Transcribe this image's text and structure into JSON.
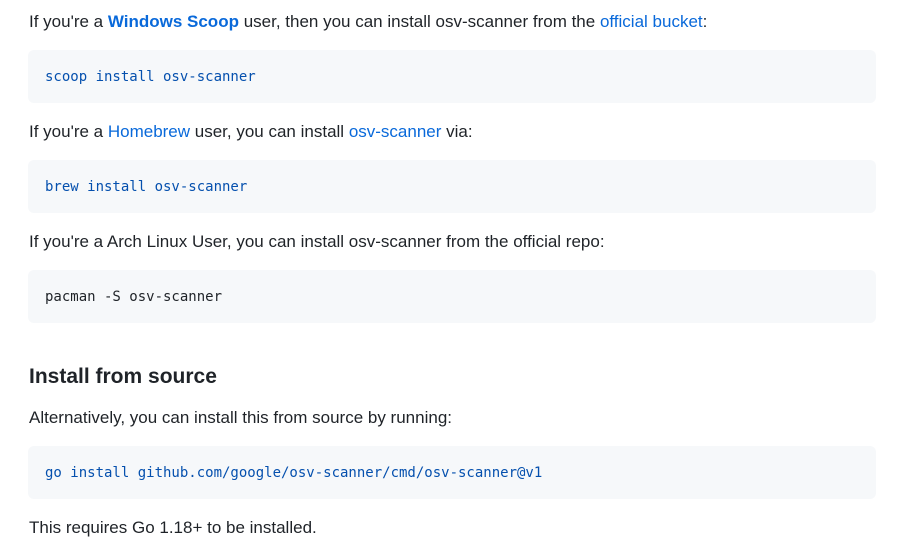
{
  "scoop_paragraph": {
    "prefix": "If you're a ",
    "windows_scoop_link": "Windows Scoop",
    "middle": " user, then you can install osv-scanner from the ",
    "official_bucket_link": "official bucket",
    "suffix": ":"
  },
  "scoop_command": "scoop install osv-scanner",
  "homebrew_paragraph": {
    "prefix": "If you're a ",
    "homebrew_link": "Homebrew",
    "middle": " user, you can install ",
    "osv_scanner_link": "osv-scanner",
    "suffix": " via:"
  },
  "brew_command": "brew install osv-scanner",
  "arch_paragraph": "If you're a Arch Linux User, you can install osv-scanner from the official repo:",
  "pacman_command": "pacman -S osv-scanner",
  "source_heading": "Install from source",
  "source_paragraph": "Alternatively, you can install this from source by running:",
  "go_command": "go install github.com/google/osv-scanner/cmd/osv-scanner@v1",
  "requirement_paragraph": "This requires Go 1.18+ to be installed.",
  "colors": {
    "link": "#0969da",
    "text": "#1f2328",
    "code_background": "#f6f8fa",
    "code_text": "#0550ae"
  }
}
